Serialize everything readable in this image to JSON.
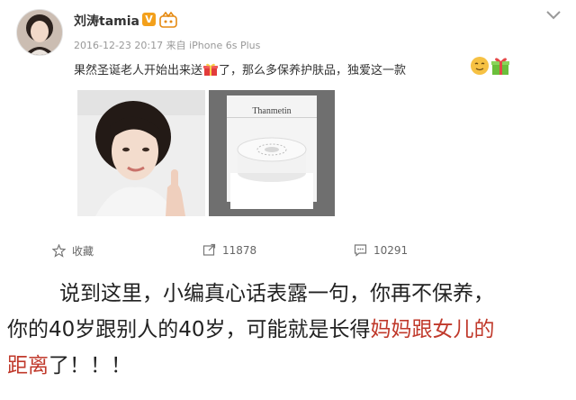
{
  "post": {
    "username": "刘涛tamia",
    "verified_badge": "V",
    "timestamp": "2016-12-23 20:17",
    "source": "来自 iPhone 6s Plus",
    "text_part1": "果然圣诞老人开始出来送",
    "text_part2": "了，那么多保养护肤品，独爱这一款",
    "product_brand": "Thanmetin",
    "images": [
      "selfie-photo",
      "product-photo"
    ]
  },
  "actions": {
    "favorite_label": "收藏",
    "repost_count": "11878",
    "comment_count": "10291"
  },
  "caption": {
    "line1": "说到这里，小编真心话表露一句，你再不保养，",
    "line2_plain": "你的40岁跟别人的40岁，可能就是长得",
    "line2_highlight": "妈妈跟女儿的",
    "line3_highlight": "距离",
    "line3_plain": "了！！！"
  },
  "colors": {
    "highlight": "#c0392b",
    "meta_gray": "#999999",
    "badge_orange": "#f3a01b"
  }
}
